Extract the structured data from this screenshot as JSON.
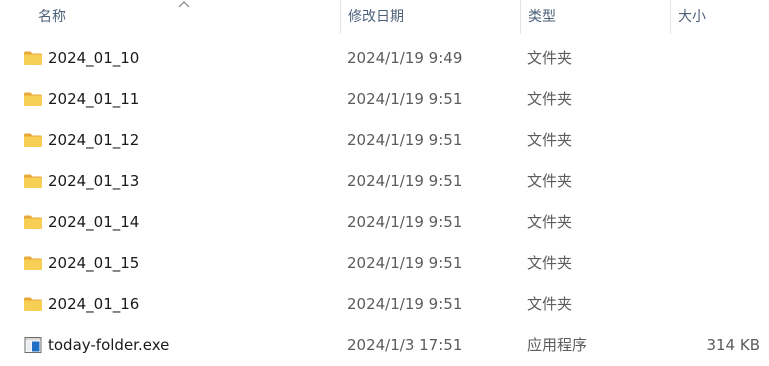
{
  "columns": {
    "name": "名称",
    "modified": "修改日期",
    "type": "类型",
    "size": "大小"
  },
  "files": [
    {
      "name": "2024_01_10",
      "modified": "2024/1/19 9:49",
      "type": "文件夹",
      "size": "",
      "icon": "folder-icon"
    },
    {
      "name": "2024_01_11",
      "modified": "2024/1/19 9:51",
      "type": "文件夹",
      "size": "",
      "icon": "folder-icon"
    },
    {
      "name": "2024_01_12",
      "modified": "2024/1/19 9:51",
      "type": "文件夹",
      "size": "",
      "icon": "folder-icon"
    },
    {
      "name": "2024_01_13",
      "modified": "2024/1/19 9:51",
      "type": "文件夹",
      "size": "",
      "icon": "folder-icon"
    },
    {
      "name": "2024_01_14",
      "modified": "2024/1/19 9:51",
      "type": "文件夹",
      "size": "",
      "icon": "folder-icon"
    },
    {
      "name": "2024_01_15",
      "modified": "2024/1/19 9:51",
      "type": "文件夹",
      "size": "",
      "icon": "folder-icon"
    },
    {
      "name": "2024_01_16",
      "modified": "2024/1/19 9:51",
      "type": "文件夹",
      "size": "",
      "icon": "folder-icon"
    },
    {
      "name": "today-folder.exe",
      "modified": "2024/1/3 17:51",
      "type": "应用程序",
      "size": "314 KB",
      "icon": "exe-file-icon"
    }
  ],
  "colors": {
    "folder": "#f6c445",
    "folder_dark": "#e8a93a",
    "exe_blue": "#1f6fc5",
    "header_text": "#4c607a"
  }
}
